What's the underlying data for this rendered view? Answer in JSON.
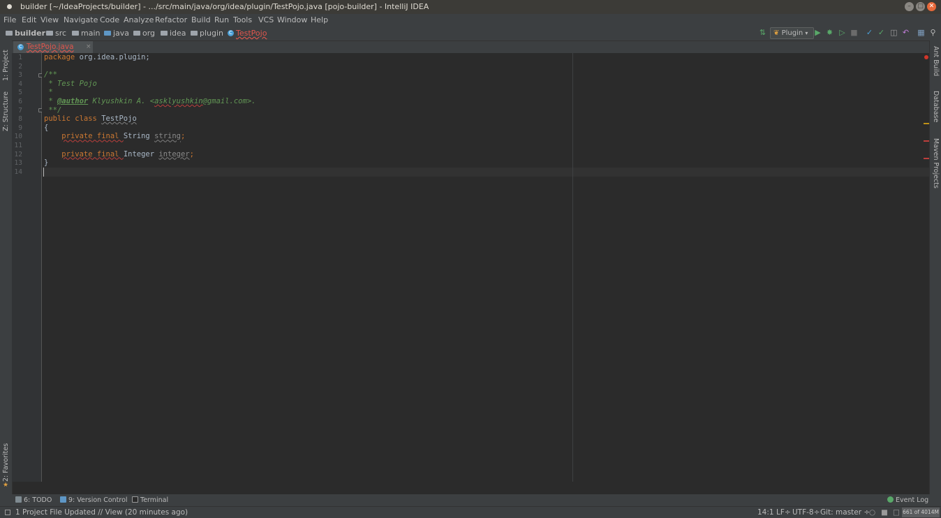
{
  "window": {
    "title": "builder [~/IdeaProjects/builder] - .../src/main/java/org/idea/plugin/TestPojo.java [pojo-builder] - IntelliJ IDEA",
    "controls": [
      "–",
      "□",
      "✕"
    ]
  },
  "menu": [
    "File",
    "Edit",
    "View",
    "Navigate",
    "Code",
    "Analyze",
    "Refactor",
    "Build",
    "Run",
    "Tools",
    "VCS",
    "Window",
    "Help"
  ],
  "breadcrumbs": [
    "builder",
    "src",
    "main",
    "java",
    "org",
    "idea",
    "plugin",
    "TestPojo"
  ],
  "toolbar": {
    "run_config": "Plugin",
    "icons": [
      "build-icon",
      "run-icon",
      "debug-icon",
      "coverage-icon",
      "stop-icon",
      "vcs-update-icon",
      "vcs-commit-icon",
      "vcs-compare-icon",
      "vcs-revert-icon",
      "project-structure-icon",
      "search-everywhere-icon"
    ]
  },
  "tabs": [
    {
      "label": "TestPojo.java",
      "close": "×"
    }
  ],
  "left_tool_windows": [
    "1: Project",
    "Z: Structure",
    "2: Favorites"
  ],
  "right_tool_windows": [
    "Ant Build",
    "Database",
    "Maven Projects"
  ],
  "editor": {
    "line_numbers": [
      "1",
      "2",
      "3",
      "4",
      "5",
      "6",
      "7",
      "8",
      "9",
      "10",
      "11",
      "12",
      "13",
      "14"
    ],
    "lines": [
      {
        "package_kw": "package",
        "package_name": " org.idea.plugin;"
      },
      {},
      {
        "comment": "/**"
      },
      {
        "comment": " * Test Pojo"
      },
      {
        "comment": " *"
      },
      {
        "comment_prefix": " * ",
        "author_tag": "@author",
        "comment_mid": " Klyushkin A. <",
        "email": "asklyushkin",
        "comment_end": "@gmail.com>."
      },
      {
        "comment": " **/"
      },
      {
        "kw": "public class ",
        "class_name": "TestPojo"
      },
      {
        "brace": "{"
      },
      {
        "indent": "    ",
        "kw": "private final ",
        "type": "String ",
        "field": "string",
        "semi": ";"
      },
      {},
      {
        "indent": "    ",
        "kw": "private final ",
        "type": "Integer ",
        "field": "integer",
        "semi": ";"
      },
      {
        "brace": "}"
      },
      {}
    ]
  },
  "bottom_tools": {
    "todo": "6: TODO",
    "version_control": "9: Version Control",
    "terminal": "Terminal",
    "event_log": "Event Log"
  },
  "status": {
    "message": "1 Project File Updated // View (20 minutes ago)",
    "position": "14:1",
    "line_sep": "LF÷",
    "encoding": "UTF-8÷",
    "git": "Git: master ÷",
    "memory": "661 of 4014M"
  },
  "colors": {
    "editor_bg": "#2b2b2b",
    "keyword": "#cc7832",
    "comment": "#629755",
    "field": "#9876aa",
    "error": "#e0564d",
    "run": "#59a869"
  }
}
